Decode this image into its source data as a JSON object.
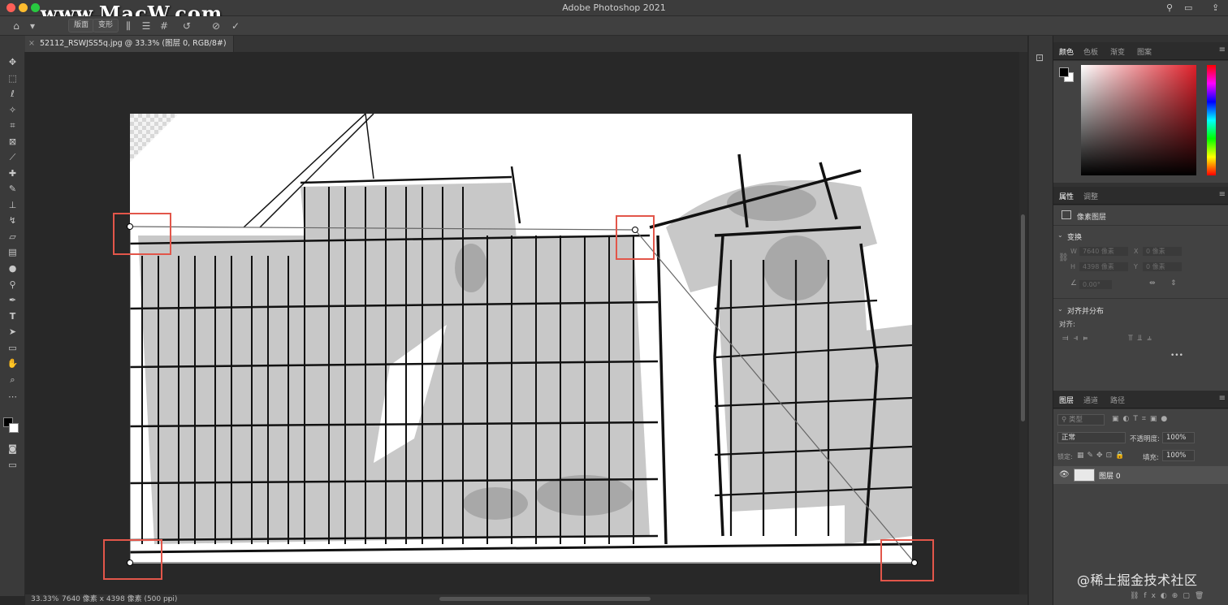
{
  "window": {
    "title": "Adobe Photoshop 2021",
    "watermark": "www.MacW.com"
  },
  "options_bar": {
    "mode_btn_1": "版面",
    "mode_btn_2": "变形"
  },
  "document": {
    "tab_title": "52112_RSWJSS5q.jpg @ 33.3% (图层 0, RGB/8#)"
  },
  "status": {
    "zoom": "33.33%",
    "dimensions": "7640 像素 x 4398 像素 (500 ppi)",
    "arrow": "›"
  },
  "color_panel": {
    "tabs": [
      "颜色",
      "色板",
      "渐变",
      "图案"
    ],
    "hue_color": "#e0202a",
    "foreground_color": "#000000",
    "background_color": "#ffffff"
  },
  "properties_panel": {
    "tabs": [
      "属性",
      "调整"
    ],
    "layer_type": "像素图层",
    "transform_title": "变换",
    "w_label": "W",
    "w_value": "7640 像素",
    "x_label": "X",
    "x_value": "0 像素",
    "h_label": "H",
    "h_value": "4398 像素",
    "y_label": "Y",
    "y_value": "0 像素",
    "angle_value": "0.00°",
    "align_title": "对齐并分布",
    "align_label": "对齐:",
    "more": "•••"
  },
  "layers_panel": {
    "tabs": [
      "图层",
      "通道",
      "路径"
    ],
    "filter_label": "类型",
    "blend_mode": "正常",
    "opacity_label": "不透明度:",
    "opacity_value": "100%",
    "lock_label": "锁定:",
    "fill_label": "填充:",
    "fill_value": "100%",
    "layers": [
      {
        "name": "图层 0",
        "visible": true
      }
    ]
  },
  "corner_watermark": "@稀土掘金技术社区"
}
